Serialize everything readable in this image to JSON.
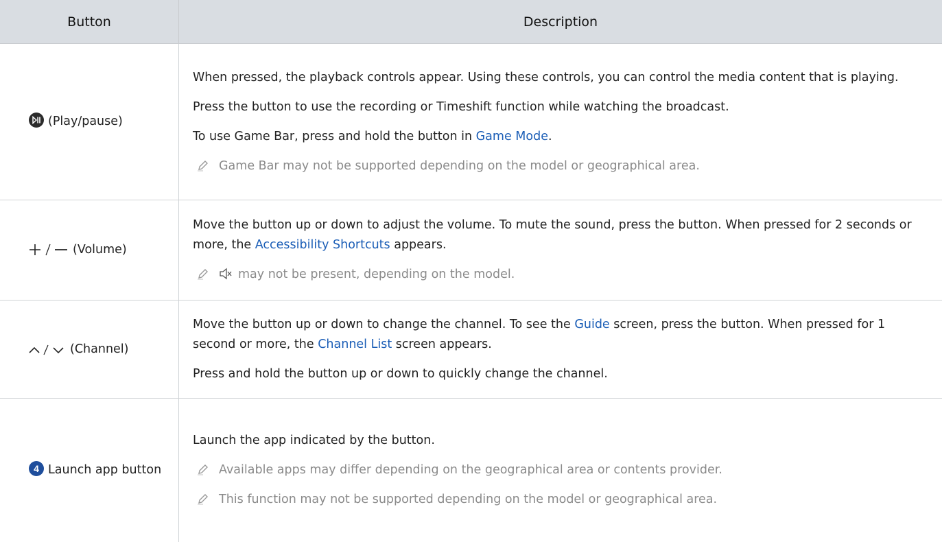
{
  "header": {
    "col_button": "Button",
    "col_description": "Description"
  },
  "rows": [
    {
      "button_label": "(Play/pause)",
      "icon": "play-pause-icon",
      "p1": "When pressed, the playback controls appear. Using these controls, you can control the media content that is playing.",
      "p2": "Press the button to use the recording or Timeshift function while watching the broadcast.",
      "p3_pre": "To use Game Bar, press and hold the button in ",
      "p3_link": "Game Mode",
      "p3_post": ".",
      "note1": "Game Bar may not be supported depending on the model or geographical area."
    },
    {
      "button_label": "(Volume)",
      "icon": "plus-minus-icon",
      "p1_pre": "Move the button up or down to adjust the volume. To mute the sound, press the button. When pressed for 2 seconds or more, the ",
      "p1_link": "Accessibility Shortcuts",
      "p1_post": " appears.",
      "note1": "may not be present, depending on the model.",
      "note_icon": "mute-icon"
    },
    {
      "button_label": "(Channel)",
      "icon": "chevron-up-down-icon",
      "p1_pre": "Move the button up or down to change the channel. To see the ",
      "p1_link": "Guide",
      "p1_mid": " screen, press the button. When pressed for 1 second or more, the ",
      "p1_link2": "Channel List",
      "p1_post": " screen appears.",
      "p2": "Press and hold the button up or down to quickly change the channel."
    },
    {
      "button_label": "Launch app button",
      "icon": "number-4-badge",
      "badge_number": "4",
      "p1": "Launch the app indicated by the button.",
      "note1": "Available apps may differ depending on the geographical area or contents provider.",
      "note2": "This function may not be supported depending on the model or geographical area."
    }
  ],
  "colors": {
    "header_bg": "#d9dde2",
    "link": "#1a5db6",
    "note_text": "#8a8a8a"
  }
}
